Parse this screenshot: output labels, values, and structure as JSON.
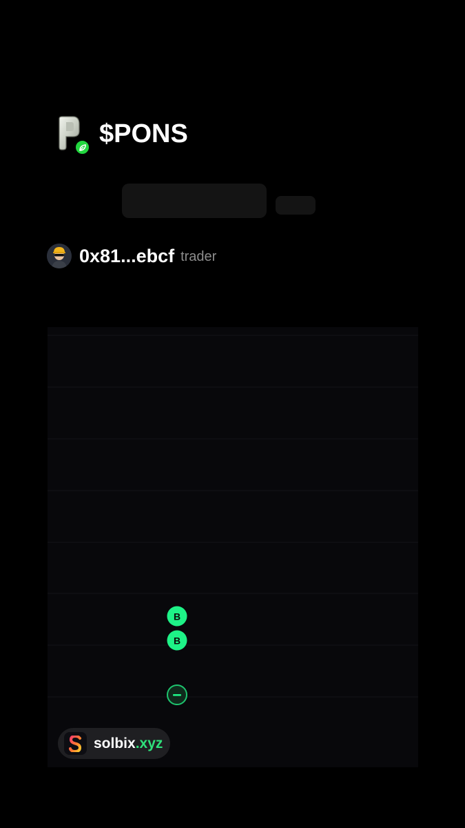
{
  "token": {
    "symbol": "$PONS",
    "logo_icon": "pons-p-logo-icon",
    "badge_icon": "leaf-badge-icon",
    "badge_color": "#22d63f"
  },
  "trader": {
    "address": "0x81...ebcf",
    "role": "trader",
    "avatar_icon": "hardhat-avatar-icon"
  },
  "chart": {
    "background": "#08080b",
    "gridline_color": "#16161c",
    "markers": [
      {
        "label": "B",
        "kind": "buy",
        "color": "#1ef287"
      },
      {
        "label": "B",
        "kind": "buy",
        "color": "#1ef287"
      },
      {
        "label": "−",
        "kind": "sell",
        "color": "#1ef287"
      }
    ]
  },
  "branding": {
    "name": "solbix",
    "tld": ".xyz",
    "logo_icon": "solbix-s-logo-icon",
    "accent": "#2fe07a"
  }
}
